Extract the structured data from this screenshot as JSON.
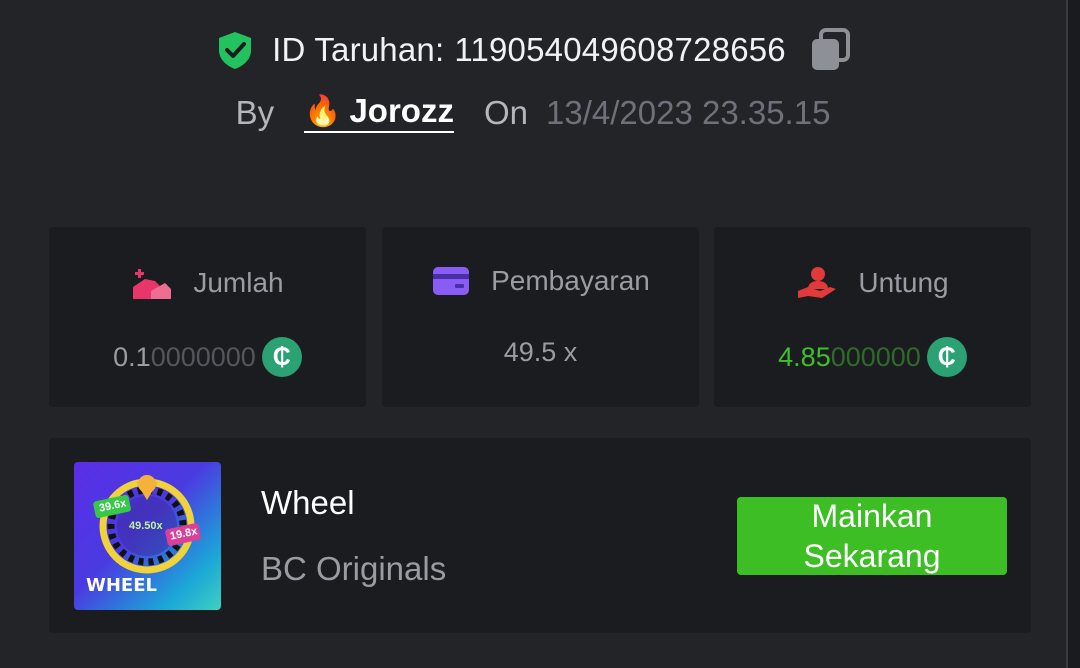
{
  "header": {
    "bet_id_label": "ID Taruhan:",
    "bet_id_value": "119054049608728656",
    "by_label": "By",
    "username": "Jorozz",
    "on_label": "On",
    "datetime": "13/4/2023 23.35.15"
  },
  "stats": {
    "amount": {
      "label": "Jumlah",
      "value_main": "0.1",
      "value_dim": "0000000",
      "icon": "bet-amount-icon"
    },
    "payout": {
      "label": "Pembayaran",
      "value": "49.5 x",
      "icon": "card-icon"
    },
    "profit": {
      "label": "Untung",
      "value_main": "4.85",
      "value_dim": "000000",
      "icon": "profit-hand-icon"
    }
  },
  "game": {
    "name": "Wheel",
    "provider": "BC Originals",
    "thumbnail_label": "WHEEL",
    "thumb_chips": [
      "39.6x",
      "49.50x",
      "19.8x"
    ],
    "play_label": "Mainkan\nSekarang"
  },
  "colors": {
    "accent_green": "#3cbe24",
    "profit_green": "#3fbf2c",
    "coin_green": "#2aa273",
    "shield_green": "#22c35e"
  }
}
